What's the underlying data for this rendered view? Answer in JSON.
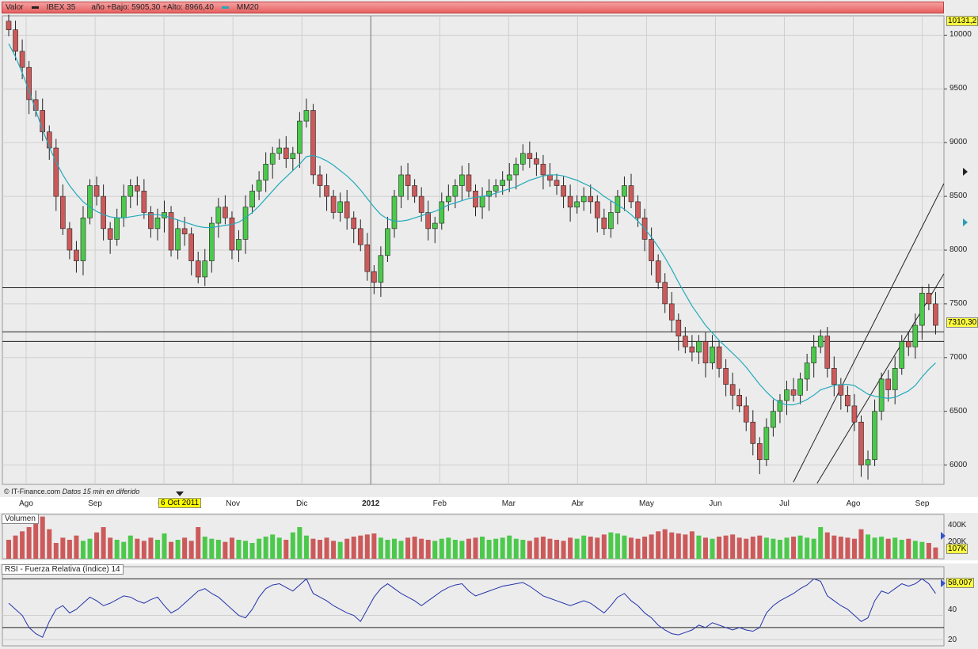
{
  "header": {
    "valor_label": "Valor",
    "series_label": "IBEX 35",
    "range_text": "año +Bajo: 5905,30 +Alto: 8966,40",
    "ma_label": "MM20",
    "price_color": "#222222",
    "ma_color": "#22aabb"
  },
  "credit": {
    "source": "© IT-Finance.com",
    "note": "Datos 15 min en diferido"
  },
  "cursor_date": "6 Oct 2011",
  "volume_panel": {
    "label": "Volumen",
    "ticks": [
      "400K",
      "200K"
    ],
    "current": "107K"
  },
  "rsi_panel": {
    "label": "RSI - Fuerza Relativa (índice) 14",
    "ticks": [
      "40",
      "20"
    ],
    "current": "58,007"
  },
  "chart_data": {
    "type": "candlestick",
    "title": "IBEX 35",
    "months": [
      "Ago",
      "Sep",
      "Oct",
      "Nov",
      "Dic",
      "2012",
      "Feb",
      "Mar",
      "Abr",
      "May",
      "Jun",
      "Jul",
      "Ago",
      "Sep"
    ],
    "y_ticks": [
      "10000",
      "9500",
      "9000",
      "8500",
      "8000",
      "7500",
      "7000",
      "6500",
      "6000"
    ],
    "ylim": [
      5820,
      10180
    ],
    "top_value_tag": "10131,2",
    "last_value_tag": "7310,30",
    "horizontal_levels": [
      7650,
      7240,
      7150
    ],
    "closes": [
      10050,
      9850,
      9700,
      9400,
      9300,
      9100,
      8950,
      8500,
      8200,
      8000,
      7900,
      8300,
      8600,
      8500,
      8200,
      8100,
      8300,
      8500,
      8600,
      8550,
      8350,
      8200,
      8300,
      8350,
      8000,
      8200,
      8150,
      7900,
      7750,
      7900,
      8250,
      8400,
      8300,
      8000,
      8100,
      8400,
      8550,
      8650,
      8800,
      8900,
      8950,
      8850,
      8900,
      9200,
      9300,
      8700,
      8600,
      8500,
      8350,
      8450,
      8300,
      8200,
      8050,
      7800,
      7700,
      7950,
      8200,
      8500,
      8700,
      8600,
      8500,
      8350,
      8200,
      8250,
      8450,
      8500,
      8600,
      8700,
      8550,
      8400,
      8500,
      8550,
      8600,
      8650,
      8700,
      8800,
      8900,
      8850,
      8800,
      8700,
      8650,
      8600,
      8500,
      8400,
      8450,
      8500,
      8450,
      8300,
      8200,
      8350,
      8500,
      8600,
      8450,
      8300,
      8100,
      7900,
      7700,
      7500,
      7350,
      7200,
      7100,
      7050,
      7150,
      6950,
      7100,
      6900,
      6750,
      6650,
      6550,
      6400,
      6200,
      6050,
      6350,
      6500,
      6600,
      6700,
      6650,
      6800,
      6950,
      7100,
      7200,
      6900,
      6750,
      6650,
      6550,
      6400,
      6000,
      6050,
      6500,
      6800,
      6700,
      6900,
      7150,
      7100,
      7300,
      7600,
      7500,
      7300
    ],
    "ma20": [
      9920,
      9800,
      9650,
      9480,
      9300,
      9120,
      8960,
      8820,
      8700,
      8600,
      8520,
      8450,
      8400,
      8360,
      8330,
      8310,
      8300,
      8300,
      8310,
      8320,
      8330,
      8330,
      8330,
      8320,
      8300,
      8280,
      8260,
      8240,
      8220,
      8210,
      8210,
      8220,
      8230,
      8240,
      8260,
      8300,
      8350,
      8410,
      8480,
      8550,
      8620,
      8680,
      8740,
      8800,
      8870,
      8880,
      8860,
      8830,
      8790,
      8740,
      8690,
      8630,
      8560,
      8480,
      8400,
      8330,
      8290,
      8270,
      8270,
      8280,
      8300,
      8320,
      8340,
      8360,
      8390,
      8420,
      8440,
      8460,
      8480,
      8490,
      8500,
      8510,
      8530,
      8550,
      8570,
      8590,
      8620,
      8650,
      8670,
      8690,
      8700,
      8700,
      8690,
      8670,
      8650,
      8620,
      8590,
      8550,
      8500,
      8460,
      8420,
      8380,
      8330,
      8270,
      8200,
      8120,
      8030,
      7930,
      7820,
      7700,
      7590,
      7480,
      7390,
      7300,
      7230,
      7160,
      7100,
      7040,
      6980,
      6910,
      6830,
      6750,
      6680,
      6620,
      6580,
      6560,
      6560,
      6580,
      6610,
      6650,
      6700,
      6720,
      6740,
      6750,
      6750,
      6740,
      6700,
      6660,
      6640,
      6630,
      6620,
      6630,
      6660,
      6690,
      6740,
      6820,
      6890,
      6950
    ],
    "volumes": [
      180,
      220,
      260,
      300,
      350,
      400,
      280,
      150,
      200,
      180,
      220,
      170,
      190,
      250,
      300,
      200,
      180,
      160,
      220,
      190,
      170,
      200,
      180,
      240,
      160,
      180,
      200,
      170,
      300,
      210,
      190,
      180,
      160,
      200,
      180,
      170,
      150,
      190,
      210,
      230,
      200,
      180,
      250,
      300,
      220,
      190,
      180,
      200,
      170,
      160,
      190,
      210,
      220,
      230,
      240,
      200,
      180,
      190,
      170,
      200,
      210,
      190,
      180,
      170,
      190,
      200,
      180,
      170,
      190,
      200,
      210,
      180,
      190,
      200,
      220,
      190,
      180,
      170,
      200,
      210,
      190,
      180,
      170,
      200,
      190,
      220,
      210,
      200,
      230,
      250,
      240,
      220,
      200,
      190,
      210,
      230,
      260,
      280,
      250,
      240,
      230,
      260,
      220,
      200,
      190,
      210,
      220,
      230,
      200,
      190,
      210,
      220,
      200,
      190,
      180,
      200,
      210,
      220,
      200,
      190,
      300,
      250,
      220,
      210,
      200,
      190,
      280,
      230,
      200,
      210,
      190,
      200,
      180,
      190,
      170,
      160,
      150,
      107
    ],
    "rsi": [
      50,
      45,
      40,
      30,
      25,
      22,
      35,
      45,
      48,
      42,
      45,
      50,
      55,
      52,
      48,
      50,
      53,
      56,
      55,
      52,
      50,
      53,
      55,
      48,
      42,
      45,
      50,
      55,
      60,
      62,
      58,
      55,
      50,
      45,
      40,
      38,
      45,
      55,
      62,
      65,
      66,
      63,
      60,
      65,
      70,
      58,
      55,
      52,
      48,
      45,
      42,
      40,
      35,
      45,
      55,
      62,
      66,
      62,
      58,
      55,
      52,
      48,
      52,
      56,
      60,
      63,
      65,
      66,
      60,
      56,
      58,
      60,
      62,
      64,
      65,
      66,
      67,
      64,
      60,
      56,
      54,
      52,
      50,
      48,
      50,
      52,
      50,
      46,
      42,
      48,
      55,
      58,
      52,
      48,
      42,
      38,
      32,
      28,
      25,
      24,
      26,
      28,
      32,
      30,
      34,
      32,
      30,
      28,
      30,
      28,
      27,
      30,
      42,
      48,
      52,
      55,
      58,
      62,
      65,
      70,
      68,
      56,
      52,
      48,
      45,
      40,
      35,
      38,
      52,
      60,
      58,
      62,
      66,
      64,
      66,
      70,
      66,
      58
    ],
    "x": [
      0,
      1,
      2,
      3,
      4,
      5,
      6,
      7,
      8,
      9,
      10,
      11,
      12,
      13,
      14,
      15,
      16,
      17,
      18,
      19,
      20,
      21,
      22,
      23,
      24,
      25,
      26,
      27,
      28,
      29,
      30,
      31,
      32,
      33,
      34,
      35,
      36,
      37,
      38,
      39,
      40,
      41,
      42,
      43,
      44,
      45,
      46,
      47,
      48,
      49,
      50,
      51,
      52,
      53,
      54,
      55,
      56,
      57,
      58,
      59,
      60,
      61,
      62,
      63,
      64,
      65,
      66,
      67,
      68,
      69,
      70,
      71,
      72,
      73,
      74,
      75,
      76,
      77,
      78,
      79,
      80,
      81,
      82,
      83,
      84,
      85,
      86,
      87,
      88,
      89,
      90,
      91,
      92,
      93,
      94,
      95,
      96,
      97,
      98,
      99,
      100,
      101,
      102,
      103,
      104,
      105,
      106,
      107,
      108,
      109,
      110,
      111,
      112,
      113,
      114,
      115,
      116,
      117,
      118,
      119,
      120,
      121,
      122,
      123,
      124,
      125,
      126,
      127,
      128,
      129,
      130,
      131,
      132,
      133,
      134,
      135,
      136,
      137
    ],
    "up_color": "#4cc94c",
    "down_color": "#cc5a5a",
    "rsi_color": "#2233aa",
    "grid": true
  }
}
